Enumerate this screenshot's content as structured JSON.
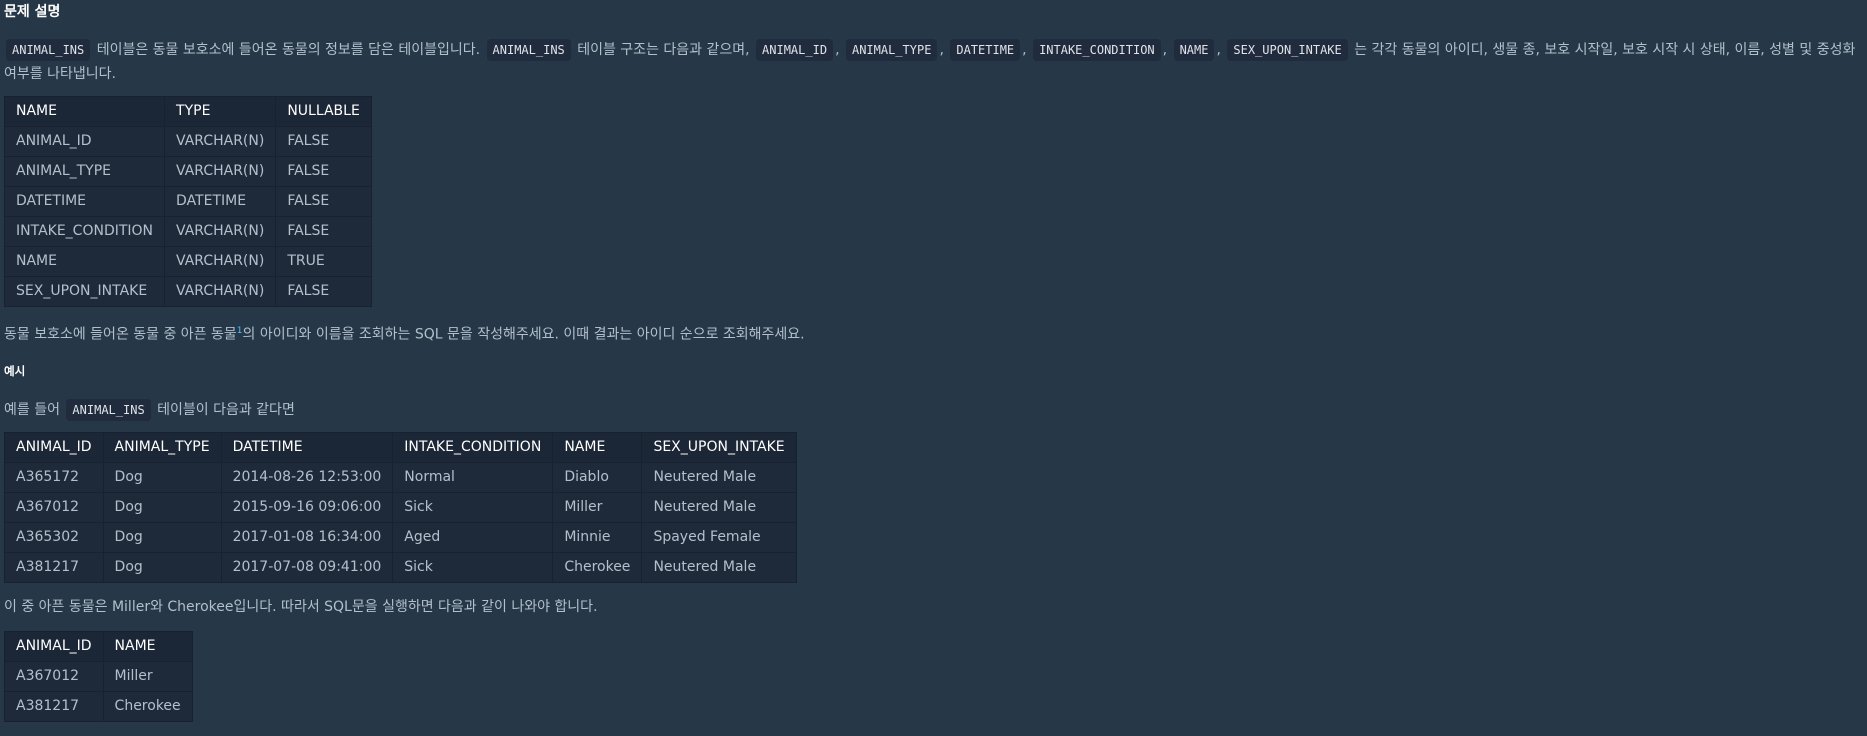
{
  "title": "문제 설명",
  "desc": {
    "code1": "ANIMAL_INS",
    "text1": " 테이블은 동물 보호소에 들어온 동물의 정보를 담은 테이블입니다. ",
    "code2": "ANIMAL_INS",
    "text2": " 테이블 구조는 다음과 같으며, ",
    "code3": "ANIMAL_ID",
    "sep1": ", ",
    "code4": "ANIMAL_TYPE",
    "sep2": ", ",
    "code5": "DATETIME",
    "sep3": ", ",
    "code6": "INTAKE_CONDITION",
    "sep4": ", ",
    "code7": "NAME",
    "sep5": ", ",
    "code8": "SEX_UPON_INTAKE",
    "text3": " 는 각각 동물의 아이디, 생물 종, 보호 시작일, 보호 시작 시 상태, 이름, 성별 및 중성화 여부를 나타냅니다."
  },
  "schema_table": {
    "headers": [
      "NAME",
      "TYPE",
      "NULLABLE"
    ],
    "rows": [
      [
        "ANIMAL_ID",
        "VARCHAR(N)",
        "FALSE"
      ],
      [
        "ANIMAL_TYPE",
        "VARCHAR(N)",
        "FALSE"
      ],
      [
        "DATETIME",
        "DATETIME",
        "FALSE"
      ],
      [
        "INTAKE_CONDITION",
        "VARCHAR(N)",
        "FALSE"
      ],
      [
        "NAME",
        "VARCHAR(N)",
        "TRUE"
      ],
      [
        "SEX_UPON_INTAKE",
        "VARCHAR(N)",
        "FALSE"
      ]
    ]
  },
  "task": {
    "text1": "동물 보호소에 들어온 동물 중 아픈 동물",
    "footnote": "1",
    "text2": "의 아이디와 이름을 조회하는 SQL 문을 작성해주세요. 이때 결과는 아이디 순으로 조회해주세요."
  },
  "example_title": "예시",
  "example_intro": {
    "text1": "예를 들어 ",
    "code": "ANIMAL_INS",
    "text2": " 테이블이 다음과 같다면"
  },
  "example_table": {
    "headers": [
      "ANIMAL_ID",
      "ANIMAL_TYPE",
      "DATETIME",
      "INTAKE_CONDITION",
      "NAME",
      "SEX_UPON_INTAKE"
    ],
    "rows": [
      [
        "A365172",
        "Dog",
        "2014-08-26 12:53:00",
        "Normal",
        "Diablo",
        "Neutered Male"
      ],
      [
        "A367012",
        "Dog",
        "2015-09-16 09:06:00",
        "Sick",
        "Miller",
        "Neutered Male"
      ],
      [
        "A365302",
        "Dog",
        "2017-01-08 16:34:00",
        "Aged",
        "Minnie",
        "Spayed Female"
      ],
      [
        "A381217",
        "Dog",
        "2017-07-08 09:41:00",
        "Sick",
        "Cherokee",
        "Neutered Male"
      ]
    ]
  },
  "result_intro": "이 중 아픈 동물은 Miller와 Cherokee입니다. 따라서 SQL문을 실행하면 다음과 같이 나와야 합니다.",
  "result_table": {
    "headers": [
      "ANIMAL_ID",
      "NAME"
    ],
    "rows": [
      [
        "A367012",
        "Miller"
      ],
      [
        "A381217",
        "Cherokee"
      ]
    ]
  }
}
